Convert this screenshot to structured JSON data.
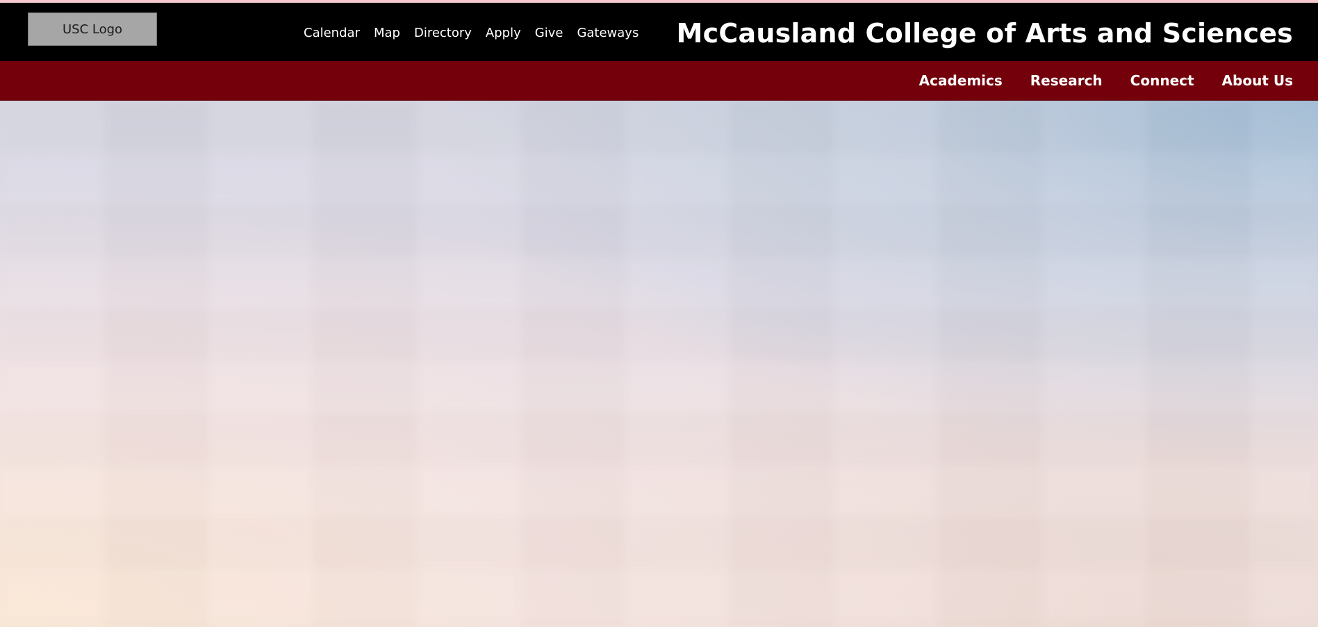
{
  "header": {
    "logo_text": "USC Logo",
    "site_title": "McCausland College of Arts and Sciences",
    "utility_links": [
      "Calendar",
      "Map",
      "Directory",
      "Apply",
      "Give",
      "Gateways"
    ]
  },
  "main_nav": {
    "items": [
      "Academics",
      "Research",
      "Connect",
      "About Us"
    ]
  },
  "colors": {
    "header_background": "#000000",
    "nav_background": "#73000a",
    "logo_placeholder": "#a6a6a6"
  }
}
